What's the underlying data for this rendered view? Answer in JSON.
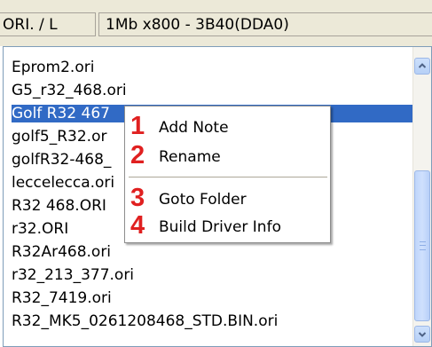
{
  "header": {
    "column1": "ORI. / L",
    "column2": "1Mb x800 - 3B40(DDA0)"
  },
  "list": {
    "items": [
      "Eprom2.ori",
      "G5_r32_468.ori",
      "Golf R32 467",
      "golf5_R32.or",
      "golfR32-468_",
      "leccelecca.ori",
      "R32 468.ORI",
      "r32.ORI",
      "R32Ar468.ori",
      "r32_213_377.ori",
      "R32_7419.ori",
      "R32_MK5_0261208468_STD.BIN.ori"
    ],
    "selected_index": 2
  },
  "context_menu": {
    "items": [
      {
        "number": "1",
        "label": "Add Note"
      },
      {
        "number": "2",
        "label": "Rename"
      },
      {
        "number": "3",
        "label": "Goto Folder"
      },
      {
        "number": "4",
        "label": "Build Driver Info"
      }
    ]
  },
  "colors": {
    "selection": "#316ac5",
    "number_annotation": "#e02020",
    "chrome": "#ece9d8"
  },
  "icons": {
    "scroll_up": "scroll-up-arrow-icon",
    "scroll_down": "scroll-down-arrow-icon"
  }
}
